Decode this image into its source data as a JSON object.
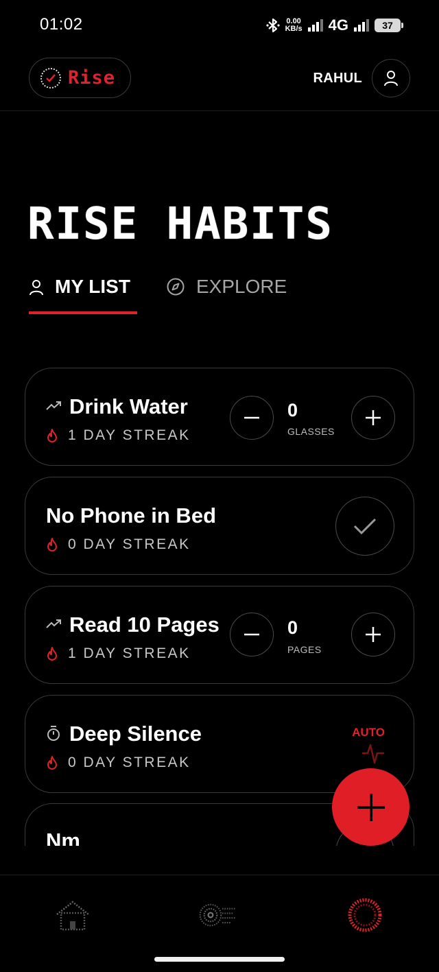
{
  "status_bar": {
    "time": "01:02",
    "net_speed_value": "0.00",
    "net_speed_unit": "KB/s",
    "network": "4G",
    "battery": "37"
  },
  "header": {
    "logo_text": "Rise",
    "user_name": "RAHUL"
  },
  "page_title": "RISE HABITS",
  "tabs": [
    {
      "label": "MY LIST",
      "active": true
    },
    {
      "label": "EXPLORE",
      "active": false
    }
  ],
  "habits": [
    {
      "name": "Drink Water",
      "streak": "1 DAY STREAK",
      "count": "0",
      "unit": "GLASSES"
    },
    {
      "name": "No Phone in Bed",
      "streak": "0 DAY STREAK"
    },
    {
      "name": "Read 10 Pages",
      "streak": "1 DAY STREAK",
      "count": "0",
      "unit": "PAGES"
    },
    {
      "name": "Deep Silence",
      "streak": "0 DAY STREAK",
      "badge": "AUTO"
    },
    {
      "name": "Nm"
    }
  ],
  "colors": {
    "accent": "#e0222a",
    "background": "#000000",
    "card_border": "#3a3a3a"
  },
  "icons": {
    "fab": "plus-icon",
    "nav": [
      "home-icon",
      "stats-icon",
      "rise-ring-icon"
    ]
  }
}
